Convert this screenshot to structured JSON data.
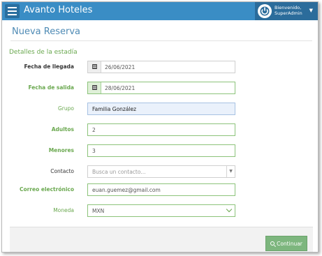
{
  "topbar": {
    "app_title": "Avanto Hoteles",
    "welcome": "Bienvenido,",
    "user": "SuperAdmin"
  },
  "page": {
    "title": "Nueva Reserva",
    "section": "Detalles de la estadía"
  },
  "form": {
    "checkin": {
      "label": "Fecha de llegada",
      "value": "26/06/2021"
    },
    "checkout": {
      "label": "Fecha de salida",
      "value": "28/06/2021"
    },
    "group": {
      "label": "Grupo",
      "value": "Familia González"
    },
    "adults": {
      "label": "Adultos",
      "value": "2"
    },
    "minors": {
      "label": "Menores",
      "value": "3"
    },
    "contact": {
      "label": "Contacto",
      "placeholder": "Busca un contacto..."
    },
    "email": {
      "label": "Correo electrónico",
      "value": "euan.guemez@gmail.com"
    },
    "currency": {
      "label": "Moneda",
      "value": "MXN"
    }
  },
  "footer": {
    "continue_label": "Continuar"
  },
  "colors": {
    "topbar": "#3a8dc5",
    "accent_green": "#6aa84f",
    "button_green": "#7db67e",
    "title_blue": "#4f8bb5"
  }
}
